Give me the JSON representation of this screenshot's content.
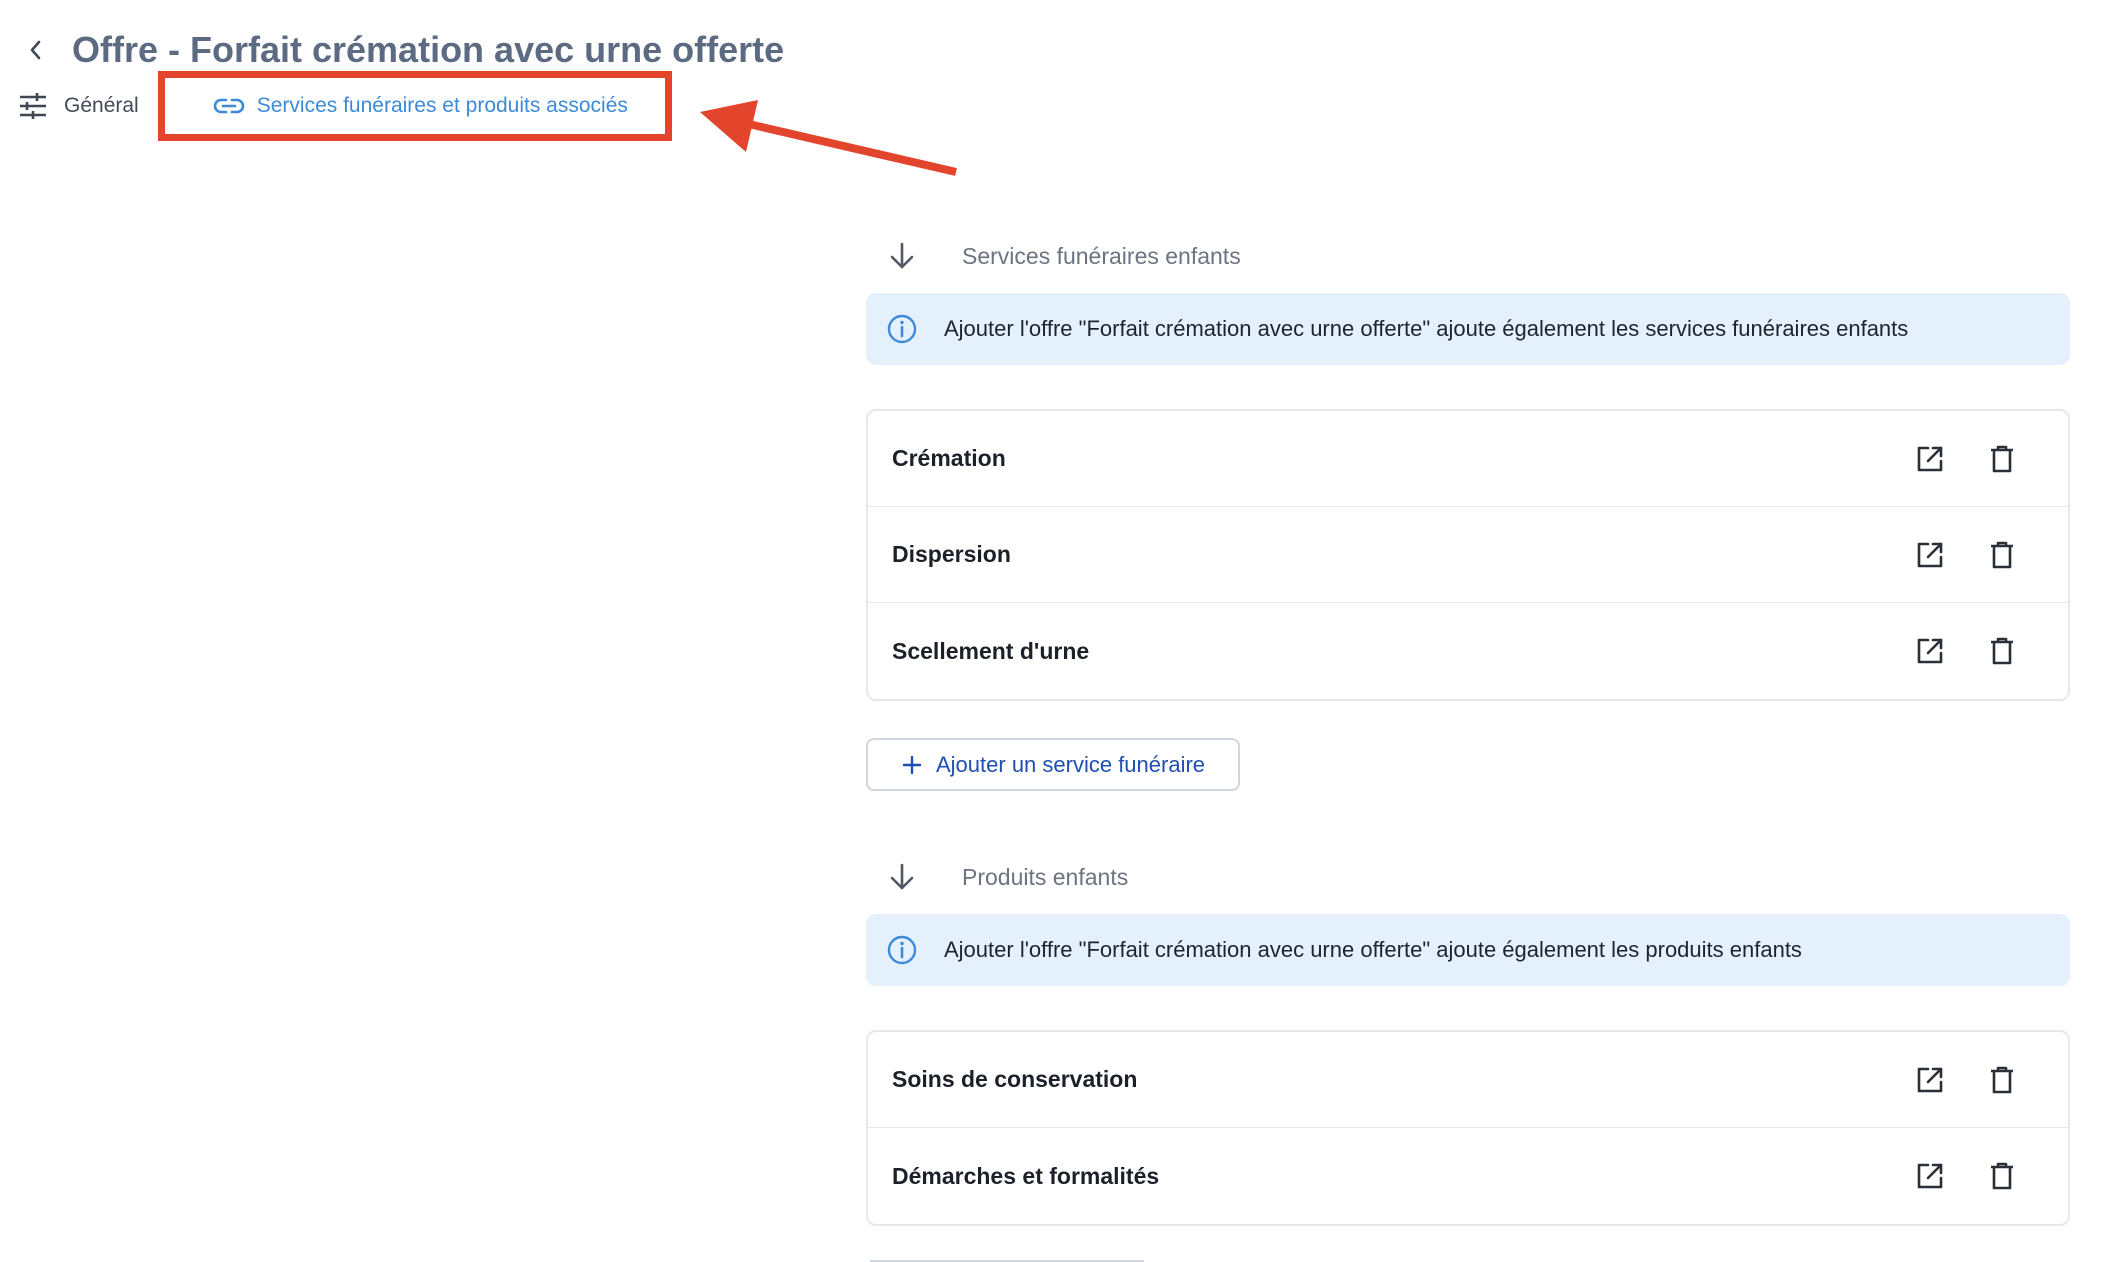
{
  "header": {
    "title": "Offre - Forfait crémation avec urne offerte"
  },
  "tabs": [
    {
      "label": "Général",
      "icon": "sliders-icon",
      "active": false
    },
    {
      "label": "Services funéraires et produits associés",
      "icon": "link-icon",
      "active": true
    }
  ],
  "annotation": {
    "highlight_color": "#e2442c"
  },
  "services_section": {
    "title": "Services funéraires enfants",
    "info": "Ajouter l'offre \"Forfait crémation avec urne offerte\" ajoute également les services funéraires enfants",
    "items": [
      {
        "label": "Crémation"
      },
      {
        "label": "Dispersion"
      },
      {
        "label": "Scellement d'urne"
      }
    ],
    "add_label": "Ajouter un service funéraire"
  },
  "products_section": {
    "title": "Produits enfants",
    "info": "Ajouter l'offre \"Forfait crémation avec urne offerte\" ajoute également les produits enfants",
    "items": [
      {
        "label": "Soins de conservation"
      },
      {
        "label": "Démarches et formalités"
      }
    ]
  },
  "colors": {
    "accent": "#3c8ad8",
    "info_bg": "#e4f0fb",
    "title": "#5d6b82",
    "button_text": "#1f4fb4"
  }
}
